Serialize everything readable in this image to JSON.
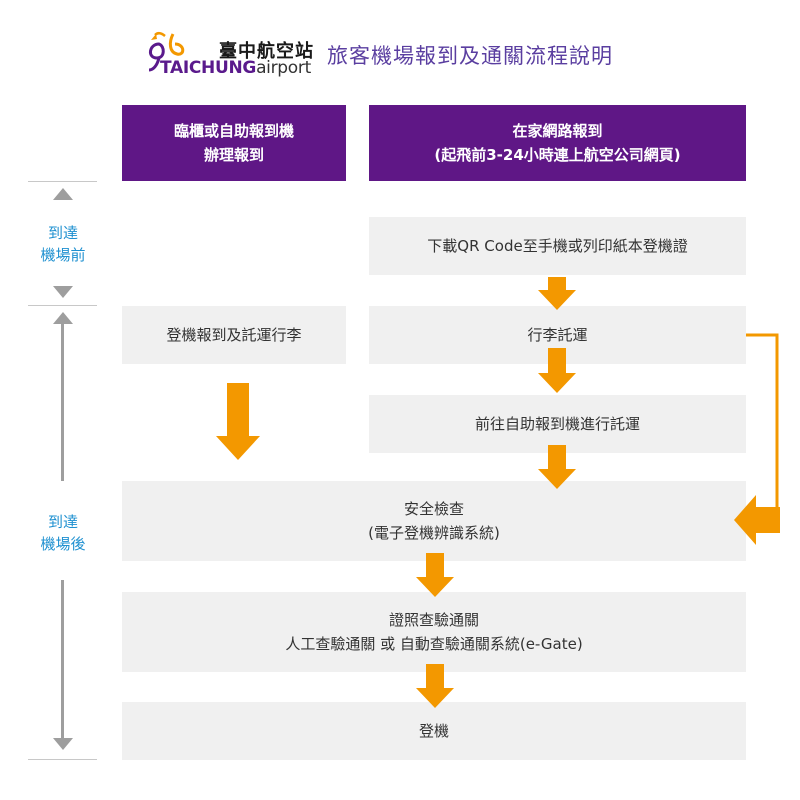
{
  "header": {
    "logo_cn": "臺中航空站",
    "logo_en_main": "TAICHUNG",
    "logo_en_sub": "airport",
    "title": "旅客機場報到及通關流程說明"
  },
  "columns": {
    "left": {
      "line1": "臨櫃或自助報到機",
      "line2": "辦理報到"
    },
    "right": {
      "line1": "在家網路報到",
      "line2": "(起飛前3-24小時連上航空公司網頁)"
    }
  },
  "axis": {
    "before": {
      "line1": "到達",
      "line2": "機場前"
    },
    "after": {
      "line1": "到達",
      "line2": "機場後"
    }
  },
  "steps": {
    "download": "下載QR Code至手機或列印紙本登機證",
    "counter_checkin": "登機報到及託運行李",
    "baggage": "行李託運",
    "kiosk_bagdrop": "前往自助報到機進行託運",
    "security_line1": "安全檢查",
    "security_line2": "(電子登機辨識系統)",
    "immigration_line1": "證照查驗通關",
    "immigration_line2": "人工查驗通關 或 自動查驗通關系統(e-Gate)",
    "boarding": "登機"
  },
  "colors": {
    "header_purple": "#5f1786",
    "arrow_orange": "#f39800",
    "box_grey": "#f0f0f0",
    "axis_blue": "#1e90d0",
    "title_purple": "#5a3ea0"
  }
}
